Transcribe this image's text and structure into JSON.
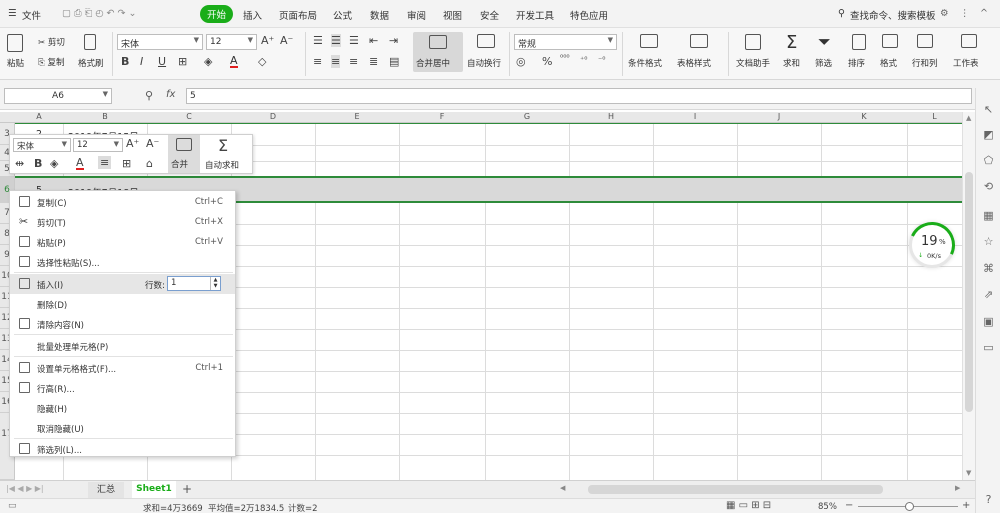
{
  "menubar": {
    "file": "文件",
    "tabs": [
      "开始",
      "插入",
      "页面布局",
      "公式",
      "数据",
      "审阅",
      "视图",
      "安全",
      "开发工具",
      "特色应用"
    ],
    "search": "查找命令、搜索模板"
  },
  "ribbon": {
    "paste": "粘贴",
    "cut": "剪切",
    "copy": "复制",
    "format_painter": "格式刷",
    "font_name": "宋体",
    "font_size": "12",
    "merge_center": "合并居中",
    "wrap_text": "自动换行",
    "number_format": "常规",
    "conditional_format": "条件格式",
    "table_style": "表格样式",
    "doc_helper": "文档助手",
    "sum": "求和",
    "filter": "筛选",
    "sort": "排序",
    "format": "格式",
    "row_col": "行和列",
    "worksheet": "工作表"
  },
  "formula_bar": {
    "cell_ref": "A6",
    "fx": "fx",
    "value": "5"
  },
  "grid": {
    "columns": [
      "A",
      "B",
      "C",
      "D",
      "E",
      "F",
      "G",
      "H",
      "I",
      "J",
      "K",
      "L"
    ],
    "rows": [
      "3",
      "4",
      "5",
      "6",
      "7",
      "8",
      "9",
      "10",
      "11",
      "12",
      "13",
      "14",
      "15",
      "16",
      "17"
    ],
    "row3_a": "2",
    "row3_b": "2019年7月15日",
    "row6_a": "5",
    "row6_b": "2019年7月18日"
  },
  "minibar": {
    "font_name": "宋体",
    "font_size": "12",
    "merge": "合并",
    "autosum": "自动求和"
  },
  "context_menu": {
    "items": [
      {
        "label": "复制(C)",
        "shortcut": "Ctrl+C"
      },
      {
        "label": "剪切(T)",
        "shortcut": "Ctrl+X"
      },
      {
        "label": "粘贴(P)",
        "shortcut": "Ctrl+V"
      },
      {
        "label": "选择性粘贴(S)...",
        "shortcut": ""
      },
      {
        "label": "插入(I)",
        "shortcut": ""
      },
      {
        "label": "删除(D)",
        "shortcut": ""
      },
      {
        "label": "清除内容(N)",
        "shortcut": ""
      },
      {
        "label": "批量处理单元格(P)",
        "shortcut": ""
      },
      {
        "label": "设置单元格格式(F)...",
        "shortcut": "Ctrl+1"
      },
      {
        "label": "行高(R)...",
        "shortcut": ""
      },
      {
        "label": "隐藏(H)",
        "shortcut": ""
      },
      {
        "label": "取消隐藏(U)",
        "shortcut": ""
      },
      {
        "label": "筛选列(L)...",
        "shortcut": ""
      }
    ],
    "rows_label": "行数:",
    "rows_value": "1"
  },
  "speed_widget": {
    "percent": "19",
    "percent_sign": "%",
    "rate": "0K/s"
  },
  "sheet_tabs": [
    "汇总",
    "Sheet1"
  ],
  "status": {
    "sum": "求和=4万3669",
    "avg": "平均值=2万1834.5",
    "count": "计数=2",
    "zoom": "85%"
  },
  "colors": {
    "accent_green": "#1aad19",
    "selection_green": "#2e8b3a",
    "speed_green": "#1aad19"
  }
}
